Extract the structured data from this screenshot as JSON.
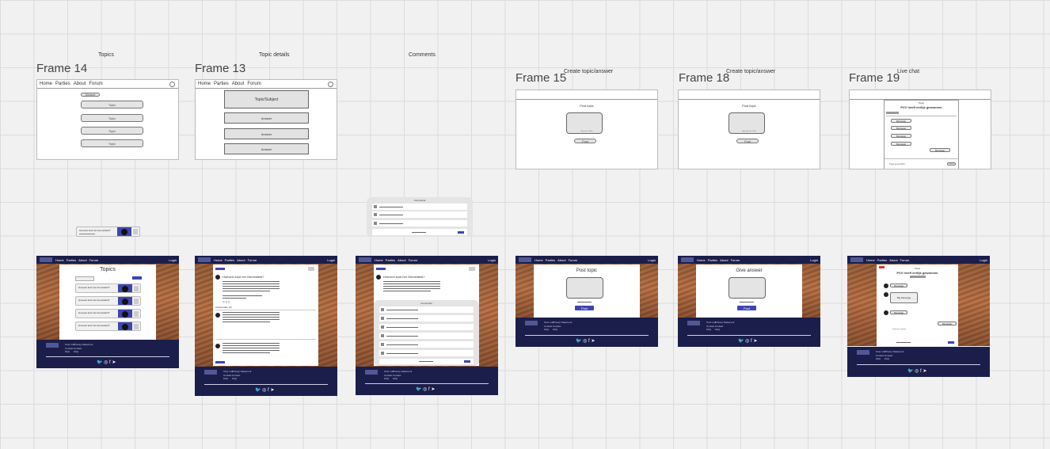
{
  "sections": {
    "topics": "Topics",
    "topic_details": "Topic details",
    "comments": "Comments",
    "create1": "Create topic/answer",
    "create2": "Create topic/answer",
    "live_chat": "Live chat"
  },
  "frames": {
    "f14": "Frame 14",
    "f13": "Frame 13",
    "f15": "Frame 15",
    "f18": "Frame 18",
    "f19": "Frame 19"
  },
  "wire_nav": {
    "home": "Home",
    "parties": "Parties",
    "about": "About",
    "forum": "Forum"
  },
  "wire14": {
    "search": "Search",
    "topics": [
      "Topic",
      "Topic",
      "Topic",
      "Topic"
    ]
  },
  "wire13": {
    "subject": "Topic/Subject",
    "answers": [
      "Answer",
      "Answer",
      "Answer"
    ]
  },
  "wire15": {
    "heading": "Post topic",
    "caption": "Name wir. / Nam",
    "post": "Post"
  },
  "wire18": {
    "heading": "Post topic",
    "caption": "Type your txt. / Nam",
    "post": "Post"
  },
  "wire19": {
    "label": "Topic",
    "title": "PVV heeft eerlijk gewonnen",
    "messages_left": [
      "Message",
      "Message",
      "Message",
      "Message"
    ],
    "message_right": "Message",
    "input": "Type je bericht...",
    "send": "Send"
  },
  "card_mini": {
    "title": "Hoeveel kost het Gemeldeld?"
  },
  "comments_mini": {
    "title": "Comments"
  },
  "hifi_nav": {
    "home": "Home",
    "parties": "Parties",
    "about": "About",
    "forum": "Forum",
    "login": "Login"
  },
  "hifi14": {
    "title": "Topics",
    "cards": [
      "Hoeveel kost het Gemeldeld?",
      "Hoeveel kost het Gemeldeld?",
      "Hoeveel kost het Gemeldeld?",
      "Hoeveel kost het Gemeldeld?"
    ]
  },
  "hifi13": {
    "question": "Hoeveel kost het Gemeldeld?",
    "answers_label": "Antwoorden (3)"
  },
  "hifi_comments": {
    "question": "Hoeveel kost het Gemeldeld?",
    "comments": "Comments"
  },
  "hifi15": {
    "heading": "Post topic",
    "post": "Post"
  },
  "hifi18": {
    "heading": "Give answer",
    "post": "Post"
  },
  "hifi19": {
    "label": "Topic",
    "title": "PVV heeft eerlijk gewonnen",
    "msg1": "Message",
    "msg_big": "Big Message",
    "msg3": "Message",
    "msg_right": "Message",
    "typing": "Someone is typing..."
  },
  "footer": {
    "col1": "Over ons",
    "col2": "Privacy Statement",
    "col3": "Contact",
    "col4": "Contact",
    "col5": "FAQ",
    "col6": "FAQ"
  },
  "social": "🐦 ◎ f ➤",
  "colors": {
    "navy": "#1b1e4b",
    "accent": "#3e45b3",
    "canvas": "#f1f1f1"
  }
}
